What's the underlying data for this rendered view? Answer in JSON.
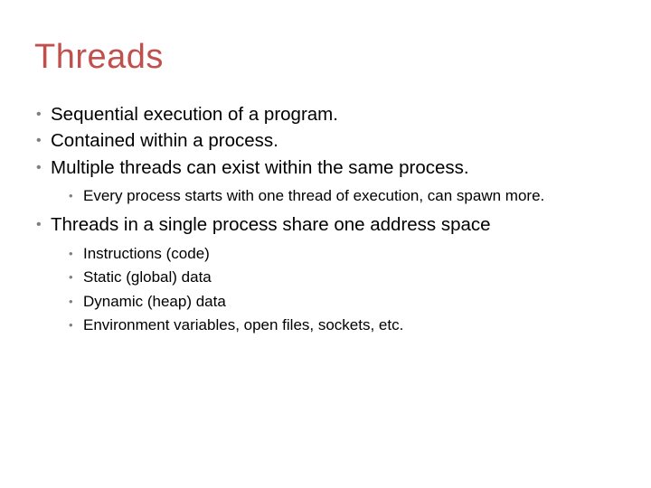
{
  "title": "Threads",
  "bullets": {
    "b0": "Sequential execution of a program.",
    "b1": "Contained within a process.",
    "b2": "Multiple threads can exist within the same process.",
    "b2_sub0": "Every process starts with one thread of execution, can spawn more.",
    "b3": "Threads in a single process share one address space",
    "b3_sub0": "Instructions (code)",
    "b3_sub1": "Static (global) data",
    "b3_sub2": "Dynamic (heap) data",
    "b3_sub3": "Environment variables, open files, sockets, etc."
  }
}
